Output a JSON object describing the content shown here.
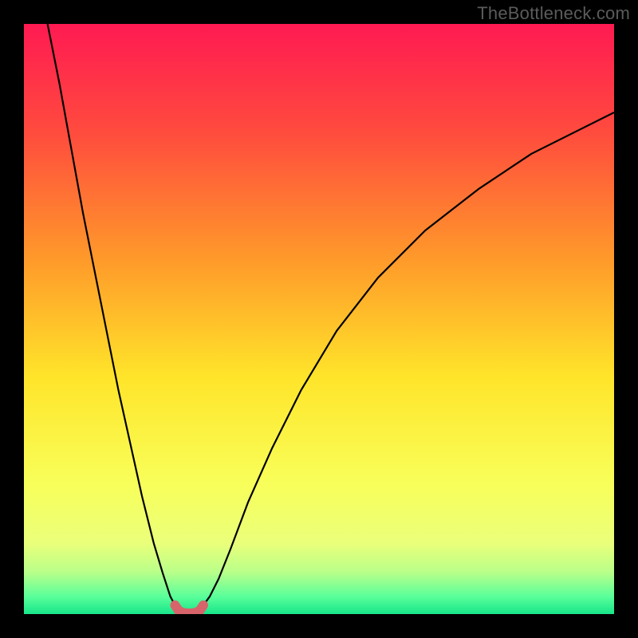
{
  "watermark": "TheBottleneck.com",
  "chart_data": {
    "type": "line",
    "title": "",
    "xlabel": "",
    "ylabel": "",
    "xlim": [
      0,
      100
    ],
    "ylim": [
      0,
      100
    ],
    "gradient_stops": [
      {
        "offset": 0,
        "color": "#ff1a52"
      },
      {
        "offset": 0.18,
        "color": "#ff4a3e"
      },
      {
        "offset": 0.4,
        "color": "#ff9a2a"
      },
      {
        "offset": 0.6,
        "color": "#ffe52a"
      },
      {
        "offset": 0.78,
        "color": "#f8ff5a"
      },
      {
        "offset": 0.88,
        "color": "#eaff7a"
      },
      {
        "offset": 0.93,
        "color": "#b8ff8a"
      },
      {
        "offset": 0.97,
        "color": "#5aff9a"
      },
      {
        "offset": 1.0,
        "color": "#17e68a"
      }
    ],
    "series": [
      {
        "name": "left-branch",
        "stroke": "#000000",
        "width": 2.2,
        "x": [
          4,
          6,
          8,
          10,
          12,
          14,
          16,
          18,
          20,
          22,
          23.5,
          24.8,
          25.6
        ],
        "y": [
          100,
          90,
          79,
          68,
          58,
          48,
          38,
          29,
          20,
          12,
          7,
          3,
          1.5
        ]
      },
      {
        "name": "right-branch",
        "stroke": "#000000",
        "width": 2.2,
        "x": [
          30.4,
          31.5,
          33,
          35,
          38,
          42,
          47,
          53,
          60,
          68,
          77,
          86,
          94,
          100
        ],
        "y": [
          1.5,
          3,
          6,
          11,
          19,
          28,
          38,
          48,
          57,
          65,
          72,
          78,
          82,
          85
        ]
      },
      {
        "name": "valley-highlight",
        "stroke": "#d7646b",
        "width": 12,
        "linecap": "round",
        "x": [
          25.6,
          26.2,
          27.0,
          28.0,
          29.0,
          29.8,
          30.4
        ],
        "y": [
          1.5,
          0.6,
          0.2,
          0.1,
          0.2,
          0.6,
          1.5
        ]
      }
    ]
  }
}
